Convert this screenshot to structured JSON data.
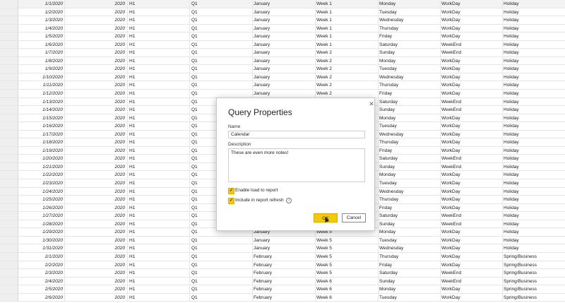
{
  "table": {
    "rows": [
      [
        "1/1/2020",
        "2020",
        "H1",
        "Q1",
        "January",
        "Week 1",
        "Monday",
        "WorkDay",
        "Holiday"
      ],
      [
        "1/2/2020",
        "2020",
        "H1",
        "Q1",
        "January",
        "Week 1",
        "Tuesday",
        "WorkDay",
        "Holiday"
      ],
      [
        "1/3/2020",
        "2020",
        "H1",
        "Q1",
        "January",
        "Week 1",
        "Wednesday",
        "WorkDay",
        "Holiday"
      ],
      [
        "1/4/2020",
        "2020",
        "H1",
        "Q1",
        "January",
        "Week 1",
        "Thursday",
        "WorkDay",
        "Holiday"
      ],
      [
        "1/5/2020",
        "2020",
        "H1",
        "Q1",
        "January",
        "Week 1",
        "Friday",
        "WorkDay",
        "Holiday"
      ],
      [
        "1/6/2020",
        "2020",
        "H1",
        "Q1",
        "January",
        "Week 1",
        "Saturday",
        "WeekEnd",
        "Holiday"
      ],
      [
        "1/7/2020",
        "2020",
        "H1",
        "Q1",
        "January",
        "Week 2",
        "Sunday",
        "WeekEnd",
        "Holiday"
      ],
      [
        "1/8/2020",
        "2020",
        "H1",
        "Q1",
        "January",
        "Week 2",
        "Monday",
        "WorkDay",
        "Holiday"
      ],
      [
        "1/9/2020",
        "2020",
        "H1",
        "Q1",
        "January",
        "Week 2",
        "Tuesday",
        "WorkDay",
        "Holiday"
      ],
      [
        "1/10/2020",
        "2020",
        "H1",
        "Q1",
        "January",
        "Week 2",
        "Wednesday",
        "WorkDay",
        "Holiday"
      ],
      [
        "1/11/2020",
        "2020",
        "H1",
        "Q1",
        "January",
        "Week 2",
        "Thursday",
        "WorkDay",
        "Holiday"
      ],
      [
        "1/12/2020",
        "2020",
        "H1",
        "Q1",
        "January",
        "Week 2",
        "Friday",
        "WorkDay",
        "Holiday"
      ],
      [
        "1/13/2020",
        "2020",
        "H1",
        "Q1",
        "",
        "",
        "Saturday",
        "WeekEnd",
        "Holiday"
      ],
      [
        "1/14/2020",
        "2020",
        "H1",
        "Q1",
        "",
        "",
        "Sunday",
        "WeekEnd",
        "Holiday"
      ],
      [
        "1/15/2020",
        "2020",
        "H1",
        "Q1",
        "",
        "",
        "Monday",
        "WorkDay",
        "Holiday"
      ],
      [
        "1/16/2020",
        "2020",
        "H1",
        "Q1",
        "",
        "",
        "Tuesday",
        "WorkDay",
        "Holiday"
      ],
      [
        "1/17/2020",
        "2020",
        "H1",
        "Q1",
        "",
        "",
        "Wednesday",
        "WorkDay",
        "Holiday"
      ],
      [
        "1/18/2020",
        "2020",
        "H1",
        "Q1",
        "",
        "",
        "Thursday",
        "WorkDay",
        "Holiday"
      ],
      [
        "1/19/2020",
        "2020",
        "H1",
        "Q1",
        "",
        "",
        "Friday",
        "WorkDay",
        "Holiday"
      ],
      [
        "1/20/2020",
        "2020",
        "H1",
        "Q1",
        "",
        "",
        "Saturday",
        "WeekEnd",
        "Holiday"
      ],
      [
        "1/21/2020",
        "2020",
        "H1",
        "Q1",
        "",
        "",
        "Sunday",
        "WeekEnd",
        "Holiday"
      ],
      [
        "1/22/2020",
        "2020",
        "H1",
        "Q1",
        "",
        "",
        "Monday",
        "WorkDay",
        "Holiday"
      ],
      [
        "1/23/2020",
        "2020",
        "H1",
        "Q1",
        "",
        "",
        "Tuesday",
        "WorkDay",
        "Holiday"
      ],
      [
        "1/24/2020",
        "2020",
        "H1",
        "Q1",
        "",
        "",
        "Wednesday",
        "WorkDay",
        "Holiday"
      ],
      [
        "1/25/2020",
        "2020",
        "H1",
        "Q1",
        "",
        "",
        "Thursday",
        "WorkDay",
        "Holiday"
      ],
      [
        "1/26/2020",
        "2020",
        "H1",
        "Q1",
        "",
        "",
        "Friday",
        "WorkDay",
        "Holiday"
      ],
      [
        "1/27/2020",
        "2020",
        "H1",
        "Q1",
        "",
        "",
        "Saturday",
        "WeekEnd",
        "Holiday"
      ],
      [
        "1/28/2020",
        "2020",
        "H1",
        "Q1",
        "",
        "",
        "Sunday",
        "WeekEnd",
        "Holiday"
      ],
      [
        "1/29/2020",
        "2020",
        "H1",
        "Q1",
        "January",
        "Week 5",
        "Monday",
        "WorkDay",
        "Holiday"
      ],
      [
        "1/30/2020",
        "2020",
        "H1",
        "Q1",
        "January",
        "Week 5",
        "Tuesday",
        "WorkDay",
        "Holiday"
      ],
      [
        "1/31/2020",
        "2020",
        "H1",
        "Q1",
        "January",
        "Week 5",
        "Wednesday",
        "WorkDay",
        "Holiday"
      ],
      [
        "2/1/2020",
        "2020",
        "H1",
        "Q1",
        "February",
        "Week 5",
        "Thursday",
        "WorkDay",
        "Spring/Business"
      ],
      [
        "2/2/2020",
        "2020",
        "H1",
        "Q1",
        "February",
        "Week 5",
        "Friday",
        "WorkDay",
        "Spring/Business"
      ],
      [
        "2/3/2020",
        "2020",
        "H1",
        "Q1",
        "February",
        "Week 5",
        "Saturday",
        "WeekEnd",
        "Spring/Business"
      ],
      [
        "2/4/2020",
        "2020",
        "H1",
        "Q1",
        "February",
        "Week 6",
        "Sunday",
        "WeekEnd",
        "Spring/Business"
      ],
      [
        "2/5/2020",
        "2020",
        "H1",
        "Q1",
        "February",
        "Week 6",
        "Monday",
        "WorkDay",
        "Spring/Business"
      ],
      [
        "2/6/2020",
        "2020",
        "H1",
        "Q1",
        "February",
        "Week 6",
        "Tuesday",
        "WorkDay",
        "Spring/Business"
      ]
    ]
  },
  "dialog": {
    "title": "Query Properties",
    "name_label": "Name",
    "name_value": "Calendar",
    "description_label": "Description",
    "description_value": "These are even more notes!",
    "enable_load_label": "Enable load to report",
    "enable_load_checked": true,
    "include_refresh_label": "Include in report refresh",
    "include_refresh_checked": true,
    "ok_label": "OK",
    "cancel_label": "Cancel",
    "close_glyph": "✕",
    "check_glyph": "✓",
    "info_glyph": "i",
    "icons": {
      "close": "close-icon",
      "checkbox": "checkbox-checked-icon",
      "info": "info-icon",
      "cursor": "mouse-pointer-icon"
    },
    "accent_color": "#f2c811"
  }
}
